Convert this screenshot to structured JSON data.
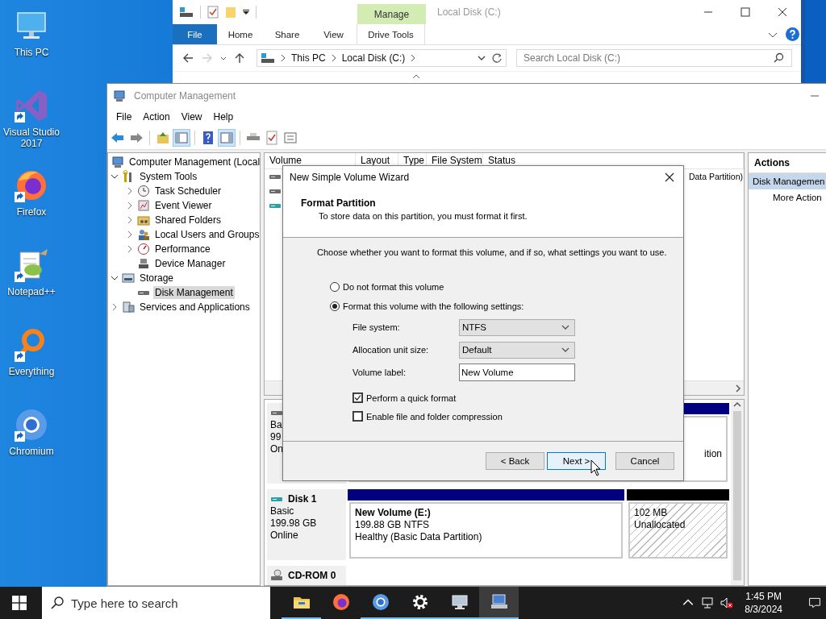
{
  "desktop": {
    "icons": [
      {
        "label": "This PC",
        "kind": "pc",
        "shortcut": false
      },
      {
        "label": "Visual Studio 2017",
        "kind": "vs",
        "shortcut": true
      },
      {
        "label": "Firefox",
        "kind": "firefox",
        "shortcut": true
      },
      {
        "label": "Notepad++",
        "kind": "notepad",
        "shortcut": true
      },
      {
        "label": "Everything",
        "kind": "everything",
        "shortcut": true
      },
      {
        "label": "Chromium",
        "kind": "chromium",
        "shortcut": true
      }
    ]
  },
  "explorer": {
    "title": "Local Disk (C:)",
    "context_group": "Manage",
    "ribbon_tabs": [
      {
        "label": "File",
        "kind": "file"
      },
      {
        "label": "Home",
        "kind": "plain"
      },
      {
        "label": "Share",
        "kind": "plain"
      },
      {
        "label": "View",
        "kind": "plain"
      },
      {
        "label": "Drive Tools",
        "kind": "context"
      }
    ],
    "breadcrumb": [
      "This PC",
      "Local Disk (C:)"
    ],
    "search": {
      "placeholder": "Search Local Disk (C:)"
    }
  },
  "computer_management": {
    "title": "Computer Management",
    "menu": [
      "File",
      "Action",
      "View",
      "Help"
    ],
    "tree": [
      {
        "label": "Computer Management (Local",
        "kind": "computer",
        "selected": false,
        "children": [
          {
            "label": "System Tools",
            "kind": "tools",
            "expanded": true,
            "selected": false,
            "children": [
              {
                "label": "Task Scheduler",
                "kind": "clock",
                "expanded": false,
                "selected": false
              },
              {
                "label": "Event Viewer",
                "kind": "event",
                "expanded": false,
                "selected": false
              },
              {
                "label": "Shared Folders",
                "kind": "shared",
                "expanded": false,
                "selected": false
              },
              {
                "label": "Local Users and Groups",
                "kind": "users",
                "expanded": false,
                "selected": false
              },
              {
                "label": "Performance",
                "kind": "performance",
                "expanded": false,
                "selected": false
              },
              {
                "label": "Device Manager",
                "kind": "device",
                "selected": false
              }
            ]
          },
          {
            "label": "Storage",
            "kind": "storage",
            "expanded": true,
            "selected": false,
            "children": [
              {
                "label": "Disk Management",
                "kind": "disk",
                "selected": true
              }
            ]
          },
          {
            "label": "Services and Applications",
            "kind": "services",
            "expanded": false,
            "selected": false
          }
        ]
      }
    ],
    "volume_table": {
      "columns": [
        "Volume",
        "Layout",
        "Type",
        "File System",
        "Status"
      ],
      "rows": [
        {
          "kind": "disk",
          "status": "Data Partition)"
        },
        {
          "kind": "disk"
        },
        {
          "kind": "usb"
        }
      ]
    },
    "disks": [
      {
        "kind": "disk",
        "info": [
          "Ba",
          "99",
          "On"
        ],
        "partitions": [
          {
            "kind": "primary",
            "lines": [
              "ition"
            ]
          }
        ]
      },
      {
        "kind": "usb",
        "name": "Disk 1",
        "info": [
          "Basic",
          "199.98 GB",
          "Online"
        ],
        "partitions": [
          {
            "kind": "primary",
            "title": "New Volume  (E:)",
            "lines": [
              "199.88 GB NTFS",
              "Healthy (Basic Data Partition)"
            ]
          },
          {
            "kind": "unallocated",
            "lines": [
              "102 MB",
              "Unallocated"
            ]
          }
        ]
      },
      {
        "kind": "cdrom",
        "name": "CD-ROM 0"
      }
    ],
    "actions": {
      "header": "Actions",
      "items": [
        {
          "label": "Disk Managemen",
          "kind": "section"
        },
        {
          "label": "More Action",
          "kind": "action"
        }
      ]
    }
  },
  "dialog": {
    "title": "New Simple Volume Wizard",
    "heading": "Format Partition",
    "subheading": "To store data on this partition, you must format it first.",
    "prompt": "Choose whether you want to format this volume, and if so, what settings you want to use.",
    "options": [
      {
        "label": "Do not format this volume",
        "selected": false
      },
      {
        "label": "Format this volume with the following settings:",
        "selected": true
      }
    ],
    "settings": [
      {
        "label": "File system:",
        "kind": "dropdown",
        "value": "NTFS"
      },
      {
        "label": "Allocation unit size:",
        "kind": "dropdown",
        "value": "Default"
      },
      {
        "label": "Volume label:",
        "kind": "text",
        "value": "New Volume"
      }
    ],
    "checkboxes": [
      {
        "label": "Perform a quick format",
        "checked": true
      },
      {
        "label": "Enable file and folder compression",
        "checked": false
      }
    ],
    "buttons": [
      {
        "label": "< Back",
        "focused": false
      },
      {
        "label": "Next >",
        "focused": true
      },
      {
        "label": "Cancel",
        "focused": false
      }
    ]
  },
  "taskbar": {
    "search": {
      "placeholder": "Type here to search"
    },
    "apps": [
      {
        "kind": "folder",
        "running": true,
        "active": false
      },
      {
        "kind": "firefox",
        "running": false,
        "active": false
      },
      {
        "kind": "chromium",
        "running": true,
        "active": false
      },
      {
        "kind": "settings",
        "running": true,
        "active": false
      },
      {
        "kind": "monitor",
        "running": true,
        "active": false
      },
      {
        "kind": "computer_management",
        "running": true,
        "active": true
      }
    ],
    "time": "1:45 PM",
    "date": "8/3/2024"
  }
}
